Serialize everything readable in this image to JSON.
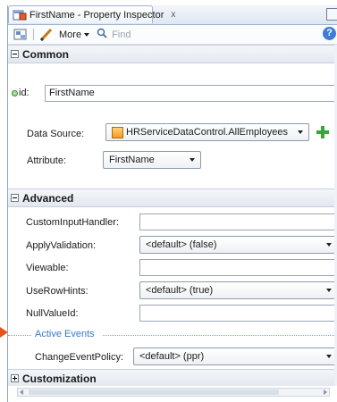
{
  "tab": {
    "title": "FirstName - Property Inspector",
    "close": "x",
    "icon": "page-edit-icon"
  },
  "toolbar": {
    "more_label": "More",
    "find_placeholder": "Find",
    "help": "?"
  },
  "sections": {
    "common": "Common",
    "advanced": "Advanced",
    "customization": "Customization"
  },
  "common": {
    "id_label": "id:",
    "id_value": "FirstName",
    "data_source_label": "Data Source:",
    "data_source_value": "HRServiceDataControl.AllEmployees",
    "attribute_label": "Attribute:",
    "attribute_value": "FirstName"
  },
  "advanced": {
    "custom_input_handler_label": "CustomInputHandler:",
    "custom_input_handler_value": "",
    "apply_validation_label": "ApplyValidation:",
    "apply_validation_value": "<default> (false)",
    "viewable_label": "Viewable:",
    "viewable_value": "",
    "use_row_hints_label": "UseRowHints:",
    "use_row_hints_value": "<default> (true)",
    "null_value_id_label": "NullValueId:",
    "null_value_id_value": "",
    "active_events_label": "Active Events",
    "change_event_policy_label": "ChangeEventPolicy:",
    "change_event_policy_value": "<default> (ppr)"
  },
  "colors": {
    "accent": "#3b78c4",
    "pointer": "#e8541c",
    "add": "#39a639"
  }
}
